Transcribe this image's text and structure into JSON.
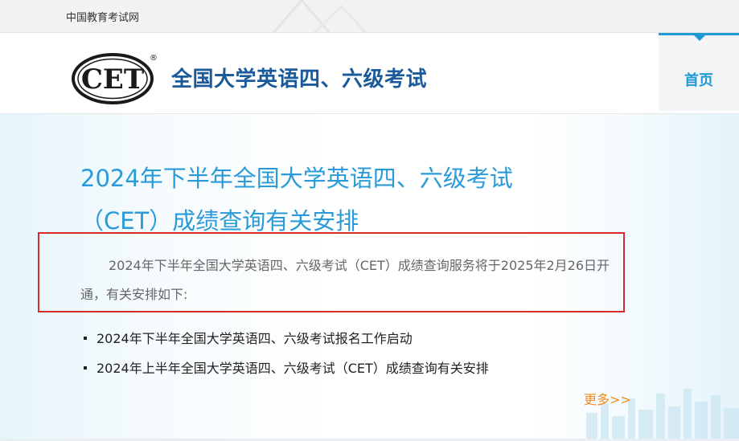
{
  "topbar": {
    "site_link": "中国教育考试网"
  },
  "header": {
    "logo_text": "CET",
    "logo_registered": "®",
    "site_title": "全国大学英语四、六级考试",
    "nav": {
      "home_label": "首页",
      "accent_color": "#1f9ad6"
    }
  },
  "article": {
    "title": "2024年下半年全国大学英语四、六级考试（CET）成绩查询有关安排",
    "summary": "2024年下半年全国大学英语四、六级考试（CET）成绩查询服务将于2025年2月26日开通，有关安排如下:",
    "title_color": "#2a9bd8",
    "highlight_border_color": "#d62b2b"
  },
  "related": [
    {
      "title": "2024年下半年全国大学英语四、六级考试报名工作启动"
    },
    {
      "title": "2024年上半年全国大学英语四、六级考试（CET）成绩查询有关安排"
    }
  ],
  "more_label": "更多>>",
  "more_color": "#f08a1c"
}
